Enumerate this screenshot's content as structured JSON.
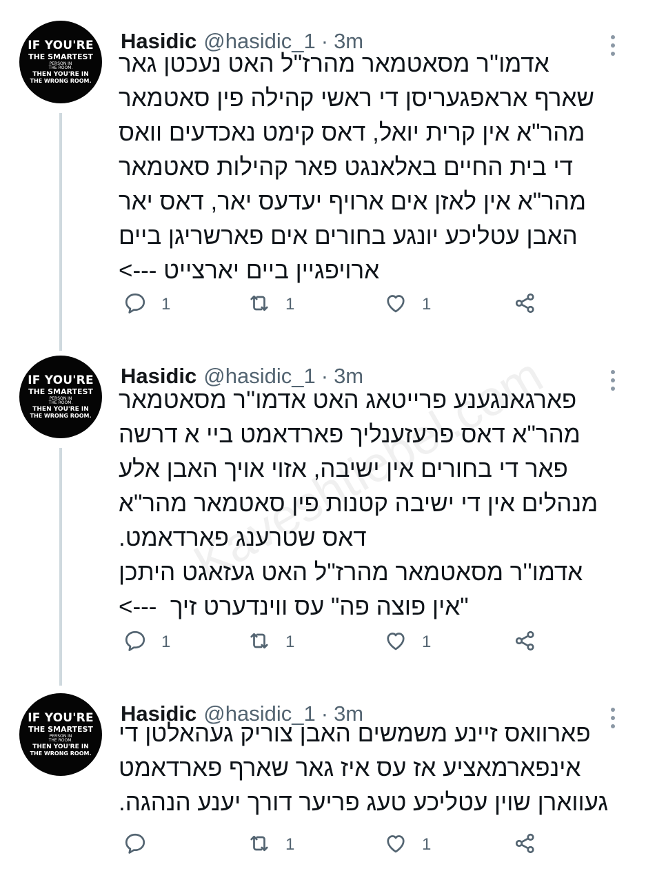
{
  "watermark": "Kaveshtiebel.com",
  "avatar": {
    "line1": "IF YOU'RE",
    "line2": "THE SMARTEST",
    "line3": "PERSON IN THE ROOM.",
    "line4": "THEN YOU'RE IN",
    "line5": "THE WRONG ROOM."
  },
  "tweets": [
    {
      "name": "Hasidic",
      "handle": "@hasidic_1",
      "separator": "·",
      "time": "3m",
      "text": "אדמו''ר מסאטמאר מהרז\"ל האט נעכטן גאר\nשארף אראפגעריסן די ראשי קהילה פין סאטמאר\nמהר\"א אין קרית יואל, דאס קימט נאכדעים וואס\nדי בית החיים באלאנגט פאר קהילות סאטמאר\nמהר\"א אין לאזן אים ארויף יעדעס יאר, דאס יאר\nהאבן עטליכע יונגע בחורים אים פארשריגן ביים\nארויפגיין ביים יארצייט --->",
      "reply_count": "1",
      "retweet_count": "1",
      "like_count": "1"
    },
    {
      "name": "Hasidic",
      "handle": "@hasidic_1",
      "separator": "·",
      "time": "3m",
      "text": "פארגאנגענע פרייטאג האט אדמו''ר מסאטמאר\nמהר\"א דאס פרעזענליך פארדאמט ביי א דרשה\nפאר די בחורים אין ישיבה, אזוי אויך האבן אלע\nמנהלים אין די ישיבה קטנות פין סאטמאר מהר\"א\nדאס שטרענג פארדאמט.\nאדמו''ר מסאטמאר מהרז\"ל האט געזאגט היתכן\n\"אין פוצה פה\" עס ווינדערט זיך  --->",
      "reply_count": "1",
      "retweet_count": "1",
      "like_count": "1"
    },
    {
      "name": "Hasidic",
      "handle": "@hasidic_1",
      "separator": "·",
      "time": "3m",
      "text": "פארוואס זיינע משמשים האבן צוריק געהאלטן די\nאינפארמאציע אז עס איז גאר שארף פארדאמט\nגעווארן שוין עטליכע טעג פריער דורך יענע הנהגה.",
      "reply_count": "",
      "retweet_count": "1",
      "like_count": "1"
    }
  ]
}
